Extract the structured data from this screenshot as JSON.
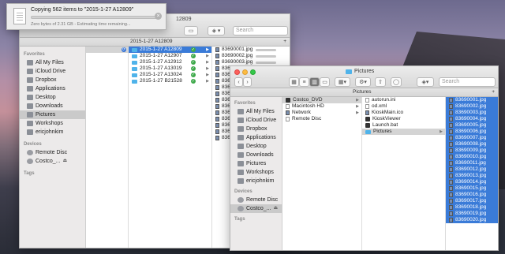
{
  "copy_dialog": {
    "title": "Copying 562 items to \"2015-1-27 A12809\"",
    "subtitle": "Zero bytes of 2.31 GB - Estimating time remaining...",
    "close_label": "×"
  },
  "back_window": {
    "title": "12809",
    "search_placeholder": "Search",
    "path_label": "2015-1-27 A12809",
    "sidebar": {
      "favorites_header": "Favorites",
      "favorites": [
        "All My Files",
        "iCloud Drive",
        "Dropbox",
        "Applications",
        "Desktop",
        "Downloads",
        "Pictures",
        "Workshops",
        "ericjohnkim"
      ],
      "devices_header": "Devices",
      "devices": [
        "Remote Disc",
        "Costco_..."
      ],
      "tags_header": "Tags"
    },
    "folders": [
      "2015-1-27 A12809",
      "2015-1-27 A12907",
      "2015-1-27 A12912",
      "2015-1-27 A13019",
      "2015-1-27 A13024",
      "2015-1-27 B21528"
    ],
    "files": [
      "83690001.jpg",
      "83690002.jpg",
      "83690003.jpg",
      "83690004.jpg",
      "83690005.jpg",
      "83690006.jpg",
      "83690007.jpg",
      "83690008.jpg",
      "83690009.jpg",
      "83690010.jpg",
      "83690011.jpg",
      "83690012.jpg",
      "83690013.jpg",
      "83690014.jpg",
      "83690015.jpg"
    ]
  },
  "front_window": {
    "title": "Pictures",
    "search_placeholder": "Search",
    "path_label": "Pictures",
    "add_label": "+",
    "sidebar": {
      "favorites_header": "Favorites",
      "favorites": [
        "All My Files",
        "iCloud Drive",
        "Dropbox",
        "Applications",
        "Desktop",
        "Downloads",
        "Pictures",
        "Workshops",
        "ericjohnkim"
      ],
      "devices_header": "Devices",
      "devices": [
        "Remote Disc",
        "Costco_..."
      ],
      "tags_header": "Tags"
    },
    "col1": [
      "Costco_DVD",
      "Macintosh HD",
      "Network",
      "Remote Disc"
    ],
    "col2": [
      "autorun.ini",
      "od.xml",
      "KioskMain.ico",
      "KioskViewer",
      "Launch.bat",
      "Pictures"
    ],
    "col3": [
      "83690001.jpg",
      "83690002.jpg",
      "83690003.jpg",
      "83690004.jpg",
      "83690005.jpg",
      "83690006.jpg",
      "83690007.jpg",
      "83690008.jpg",
      "83690009.jpg",
      "83690010.jpg",
      "83690011.jpg",
      "83690012.jpg",
      "83690013.jpg",
      "83690014.jpg",
      "83690015.jpg",
      "83690016.jpg",
      "83690017.jpg",
      "83690018.jpg",
      "83690019.jpg",
      "83690020.jpg"
    ]
  },
  "colors": {
    "selection": "#3a7bd8",
    "folder": "#4fb3ea"
  },
  "copy_progress": 0
}
